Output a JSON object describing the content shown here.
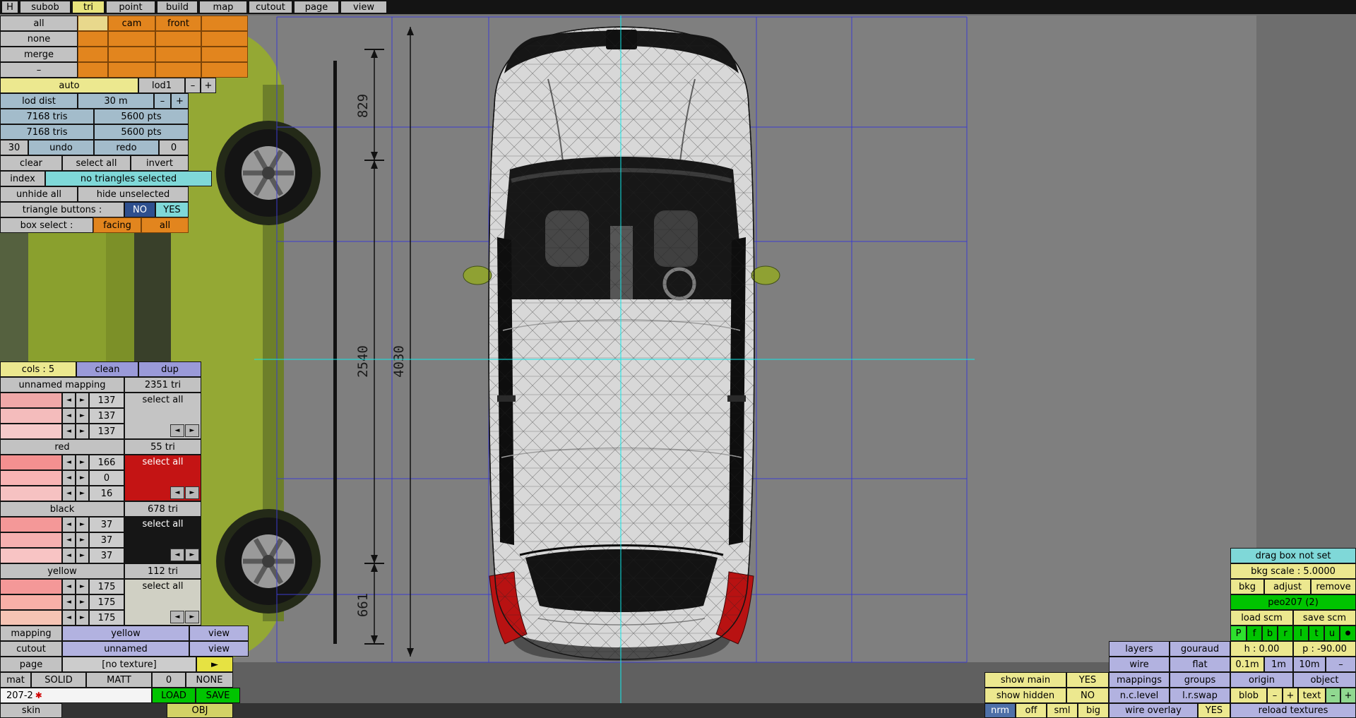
{
  "palette": {
    "orange": "#e2851e",
    "orange_pale": "#e8d88c",
    "button_gray": "#c2c2c2",
    "row_blue": "#a3bccb",
    "teal": "#7fd8d8",
    "navy": "#2e4f8e",
    "cream": "#ece88f",
    "lavender": "#b2b2e0",
    "periwinkle": "#9a9ad8",
    "green": "#00c400",
    "yellow": "#e6e242",
    "canvas_gray": "#7f7f7f",
    "blueprint_blue": "#3c3ccc",
    "crosshair_cyan": "#10eaea"
  },
  "menu": {
    "h": "H",
    "items": [
      "subob",
      "tri",
      "point",
      "build",
      "map",
      "cutout",
      "page",
      "view"
    ]
  },
  "visibility": {
    "rows": [
      "all",
      "none",
      "merge",
      "–"
    ],
    "cam": "cam",
    "front": "front"
  },
  "lod": {
    "auto": "auto",
    "lod1": "lod1",
    "minus": "–",
    "plus": "+",
    "dist_label": "lod dist",
    "dist_value": "30 m",
    "tris": "7168 tris",
    "pts": "5600 pts",
    "undo_count": "30",
    "undo": "undo",
    "redo": "redo",
    "redo_count": "0",
    "clear": "clear",
    "select_all": "select all",
    "invert": "invert",
    "index": "index",
    "status": "no triangles selected",
    "unhide_all": "unhide all",
    "hide_unselected": "hide unselected",
    "triangle_buttons_label": "triangle buttons :",
    "no": "NO",
    "yes": "YES",
    "box_select_label": "box select :",
    "facing": "facing",
    "all": "all"
  },
  "colors_panel": {
    "cols": "cols : 5",
    "clean": "clean",
    "dup": "dup",
    "select_all": "select all",
    "arrow_left": "◄",
    "arrow_right": "►",
    "groups": [
      {
        "name": "unnamed mapping",
        "count": "2351 tri",
        "values": [
          "137",
          "137",
          "137"
        ],
        "swatches": [
          "#f0a8a8",
          "#f4bcbc",
          "#f6caca"
        ],
        "bg": "#c4c4c4",
        "fg": "#000000"
      },
      {
        "name": "red",
        "count": "55 tri",
        "values": [
          "166",
          "0",
          "16"
        ],
        "swatches": [
          "#f49090",
          "#f8b4b4",
          "#f6c2c2"
        ],
        "bg": "#c41414",
        "fg": "#ffffff"
      },
      {
        "name": "black",
        "count": "678 tri",
        "values": [
          "37",
          "37",
          "37"
        ],
        "swatches": [
          "#f49898",
          "#f6b0b0",
          "#f8c4c4"
        ],
        "bg": "#161616",
        "fg": "#ffffff"
      },
      {
        "name": "yellow",
        "count": "112 tri",
        "values": [
          "175",
          "175",
          "175"
        ],
        "swatches": [
          "#f49898",
          "#f8b0a8",
          "#f6c4b4"
        ],
        "bg": "#d0d0c4",
        "fg": "#000000"
      }
    ]
  },
  "material": {
    "mapping": "mapping",
    "mapping_value": "yellow",
    "view": "view",
    "cutout": "cutout",
    "cutout_value": "unnamed",
    "page": "page",
    "page_value": "[no texture]",
    "page_next": "►",
    "mat": "mat",
    "solid": "SOLID",
    "matt": "MATT",
    "zero": "0",
    "none": "NONE",
    "file": "207-2",
    "modified": "✱",
    "load": "LOAD",
    "save": "SAVE",
    "skin": "skin",
    "obj": "OBJ"
  },
  "right": {
    "drag_box": "drag box not set",
    "bkg_scale": "bkg scale : 5.0000",
    "bkg": "bkg",
    "adjust": "adjust",
    "remove": "remove",
    "model": "peo207 (2)",
    "load_scm": "load scm",
    "save_scm": "save scm",
    "view_buttons": [
      "P",
      "f",
      "b",
      "r",
      "l",
      "t",
      "u",
      "●"
    ],
    "layers": "layers",
    "gouraud": "gouraud",
    "h_value": "h : 0.00",
    "p_value": "p : -90.00",
    "wire": "wire",
    "flat": "flat",
    "grid_01": "0.1m",
    "grid_1": "1m",
    "grid_10": "10m",
    "grid_minus": "–",
    "show_main": "show main",
    "show_main_value": "YES",
    "mappings": "mappings",
    "groups": "groups",
    "origin": "origin",
    "object": "object",
    "show_hidden": "show hidden",
    "show_hidden_value": "NO",
    "nc_level": "n.c.level",
    "lr_swap": "l.r.swap",
    "blob": "blob",
    "blob_minus": "–",
    "blob_plus": "+",
    "text": "text",
    "text_minus": "–",
    "text_plus": "+",
    "nrm": "nrm",
    "off": "off",
    "sml": "sml",
    "big": "big",
    "wire_overlay": "wire overlay",
    "wire_overlay_value": "YES",
    "reload_textures": "reload textures"
  },
  "canvas": {
    "dim_front_overhang": "829",
    "dim_wheelbase": "2540",
    "dim_total_length": "4030",
    "dim_rear_overhang": "661"
  }
}
